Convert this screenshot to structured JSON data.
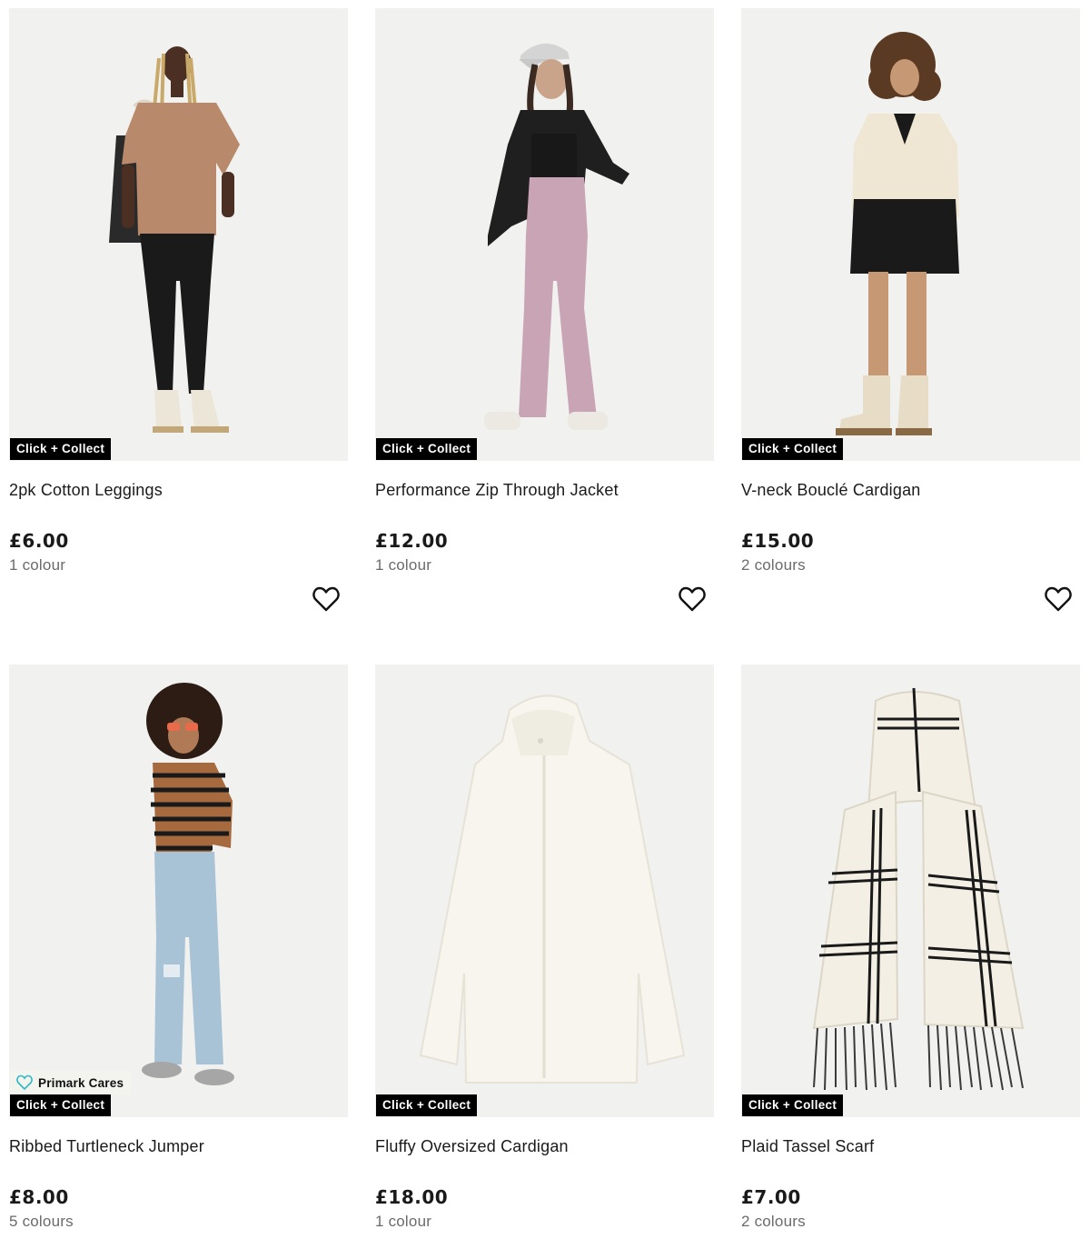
{
  "badges": {
    "click_collect": "Click + Collect",
    "primark_cares": "Primark Cares"
  },
  "colors": {
    "badge_bg": "#000000",
    "image_bg": "#f1f1f0",
    "cares_accent": "#2fb8c6",
    "secondary_text": "#6b6b6b"
  },
  "products": [
    {
      "name": "2pk Cotton Leggings",
      "price": "£6.00",
      "colours": "1 colour",
      "primark_cares": false,
      "wishlist_icon": "heart-outline-icon"
    },
    {
      "name": "Performance Zip Through Jacket",
      "price": "£12.00",
      "colours": "1 colour",
      "primark_cares": false,
      "wishlist_icon": "heart-outline-icon"
    },
    {
      "name": "V-neck Bouclé Cardigan",
      "price": "£15.00",
      "colours": "2 colours",
      "primark_cares": false,
      "wishlist_icon": "heart-outline-icon"
    },
    {
      "name": "Ribbed Turtleneck Jumper",
      "price": "£8.00",
      "colours": "5 colours",
      "primark_cares": true
    },
    {
      "name": "Fluffy Oversized Cardigan",
      "price": "£18.00",
      "colours": "1 colour",
      "primark_cares": false
    },
    {
      "name": "Plaid Tassel Scarf",
      "price": "£7.00",
      "colours": "2 colours",
      "primark_cares": false
    }
  ]
}
